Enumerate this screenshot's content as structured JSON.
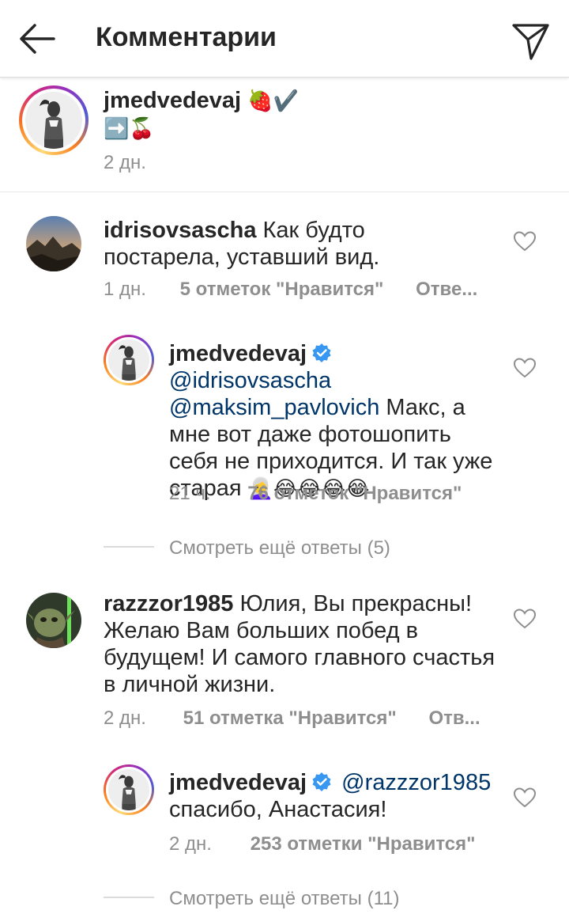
{
  "header": {
    "title": "Комментарии"
  },
  "caption": {
    "username": "jmedvedevaj",
    "text_emoji": "🍓✔️",
    "line2": "➡️🍒",
    "time": "2 дн."
  },
  "comments": [
    {
      "username": "idrisovsascha",
      "text": "Как будто постарела, уставший вид.",
      "time": "1 дн.",
      "likes": "5 отметок \"Нравится\"",
      "reply": "Отве..."
    },
    {
      "username": "jmedvedevaj",
      "mention1": "@idrisovsascha",
      "mention2": "@maksim_pavlovich",
      "text": "Макс, а мне вот даже фотошопить себя не приходится. И так уже старая",
      "emoji": "👩‍🦳😂😂😂😂",
      "time": "21 ч.",
      "likes": "76 отметок \"Нравится\""
    },
    {
      "view_more": "Смотреть ещё ответы (5)"
    },
    {
      "username": "razzzor1985",
      "text": "Юлия, Вы прекрасны! Желаю Вам больших побед в будущем! И самого главного счастья в личной жизни.",
      "time": "2 дн.",
      "likes": "51 отметка \"Нравится\"",
      "reply": "Отв..."
    },
    {
      "username": "jmedvedevaj",
      "mention": "@razzzor1985",
      "text": "спасибо, Анастасия!",
      "time": "2 дн.",
      "likes": "253 отметки \"Нравится\""
    },
    {
      "view_more": "Смотреть ещё ответы (11)"
    }
  ],
  "colors": {
    "link": "#003569",
    "muted": "#8e8e8e",
    "verified": "#3897f0"
  },
  "icons": [
    "back-arrow-icon",
    "send-icon",
    "heart-icon",
    "verified-icon"
  ]
}
